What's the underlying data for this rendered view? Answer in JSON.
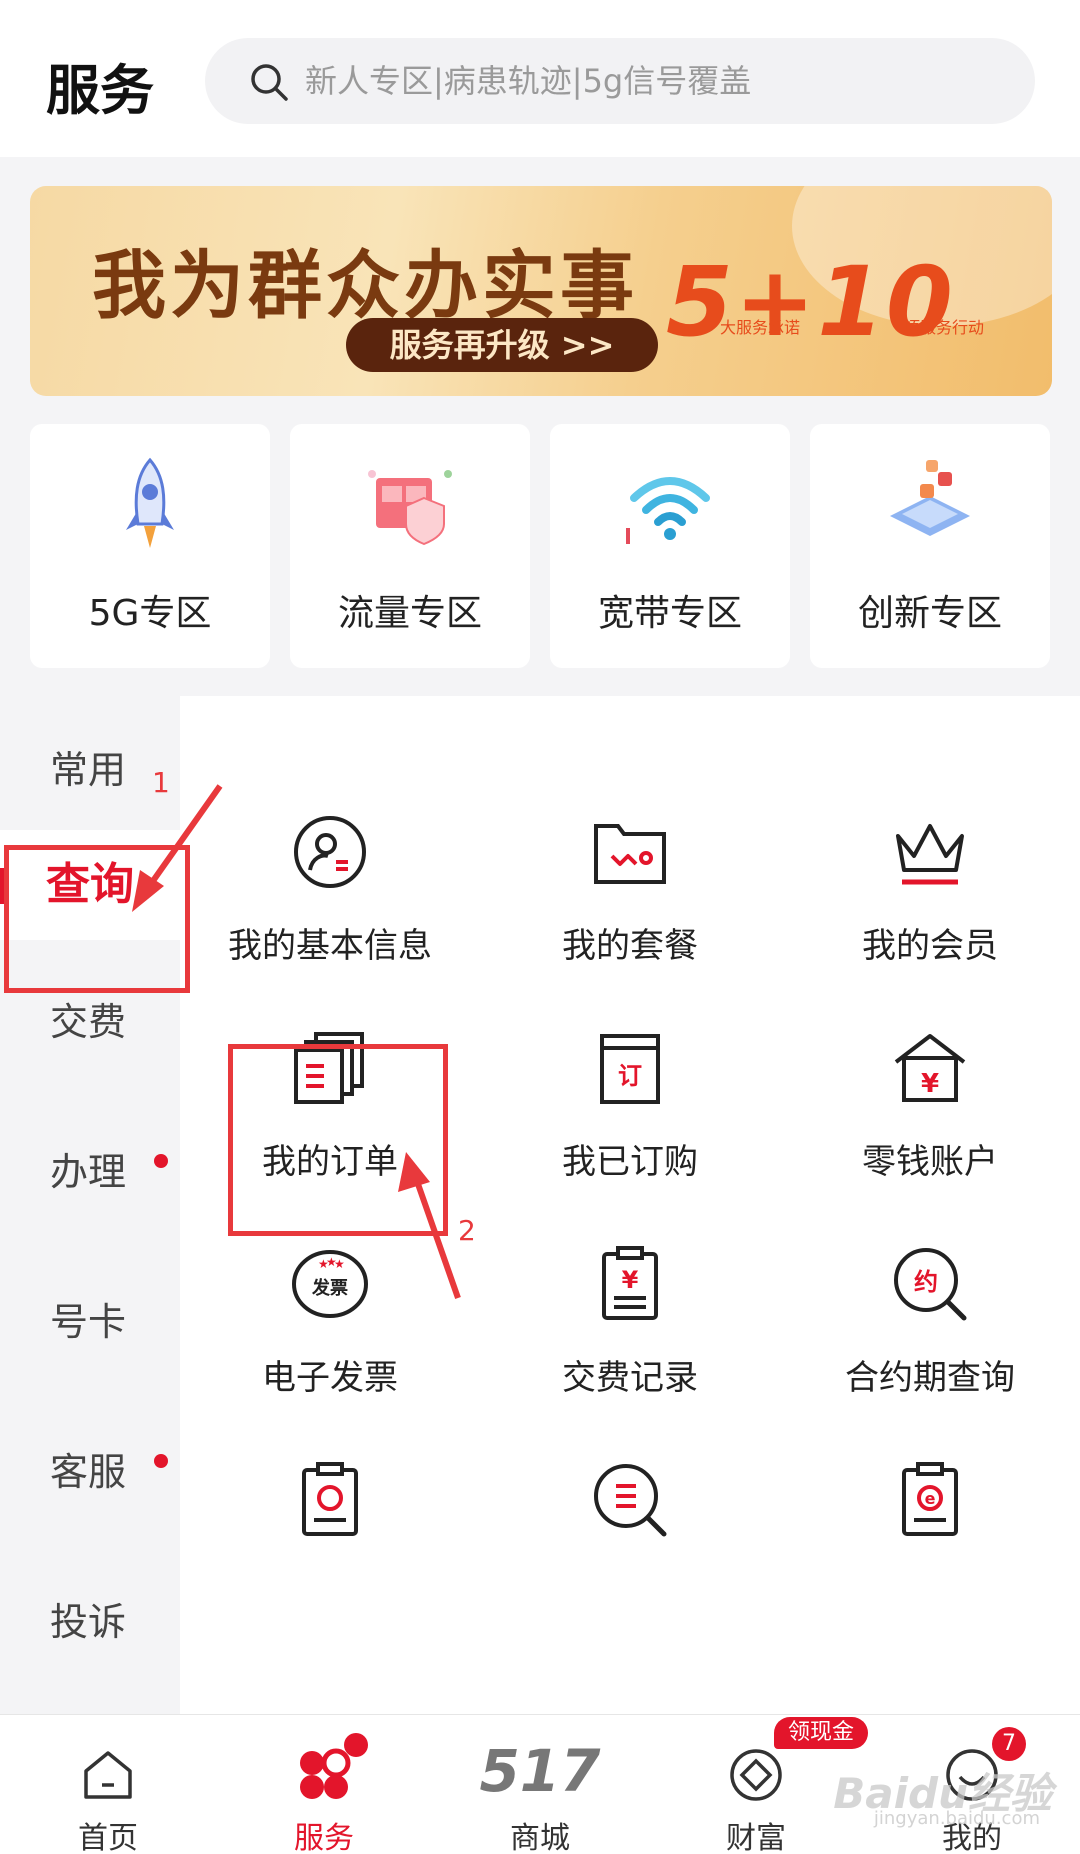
{
  "header": {
    "title": "服务",
    "search_placeholder": "新人专区|病患轨迹|5g信号覆盖"
  },
  "banner": {
    "title": "我为群众办实事",
    "button": "服务再升级 >>",
    "numbers": "5+10",
    "sub1": "大服务承诺",
    "sub2": "项服务行动"
  },
  "zones": [
    {
      "label": "5G专区",
      "icon": "rocket-icon"
    },
    {
      "label": "流量专区",
      "icon": "data-box-icon"
    },
    {
      "label": "宽带专区",
      "icon": "wifi-icon"
    },
    {
      "label": "创新专区",
      "icon": "innovation-icon"
    }
  ],
  "categories": [
    {
      "label": "常用",
      "active": false,
      "dot": false
    },
    {
      "label": "查询",
      "active": true,
      "dot": false
    },
    {
      "label": "交费",
      "active": false,
      "dot": false
    },
    {
      "label": "办理",
      "active": false,
      "dot": true
    },
    {
      "label": "号卡",
      "active": false,
      "dot": false
    },
    {
      "label": "客服",
      "active": false,
      "dot": true
    },
    {
      "label": "投诉",
      "active": false,
      "dot": false
    }
  ],
  "grid": [
    {
      "label": "我的基本信息",
      "icon": "user-info-icon"
    },
    {
      "label": "我的套餐",
      "icon": "plan-folder-icon"
    },
    {
      "label": "我的会员",
      "icon": "crown-icon"
    },
    {
      "label": "我的订单",
      "icon": "order-stack-icon"
    },
    {
      "label": "我已订购",
      "icon": "subscribed-icon"
    },
    {
      "label": "零钱账户",
      "icon": "wallet-house-icon"
    },
    {
      "label": "电子发票",
      "icon": "invoice-icon"
    },
    {
      "label": "交费记录",
      "icon": "payment-record-icon"
    },
    {
      "label": "合约期查询",
      "icon": "contract-search-icon"
    },
    {
      "label": "",
      "icon": "clipboard-refresh-icon"
    },
    {
      "label": "",
      "icon": "search-list-icon"
    },
    {
      "label": "",
      "icon": "clipboard-e-icon"
    }
  ],
  "grid_icon_text": {
    "subscribed": "订",
    "wallet": "¥",
    "invoice": "发票",
    "payment": "¥",
    "contract": "约",
    "e_invoice": "e"
  },
  "annotations": {
    "num1": "1",
    "num2": "2"
  },
  "tabbar": [
    {
      "label": "首页",
      "icon": "home-icon",
      "active": false
    },
    {
      "label": "服务",
      "icon": "service-icon",
      "active": true
    },
    {
      "label": "商城",
      "icon": "mall-517",
      "big": "517",
      "active": false
    },
    {
      "label": "财富",
      "icon": "wealth-icon",
      "active": false,
      "badge": "领现金"
    },
    {
      "label": "我的",
      "icon": "profile-icon",
      "active": false,
      "count": "7"
    }
  ],
  "watermark": {
    "main": "Baidu经验",
    "sub": "jingyan.baidu.com"
  },
  "colors": {
    "accent": "#e3152b",
    "annotation": "#e8393c",
    "banner_text": "#7a3a10"
  }
}
